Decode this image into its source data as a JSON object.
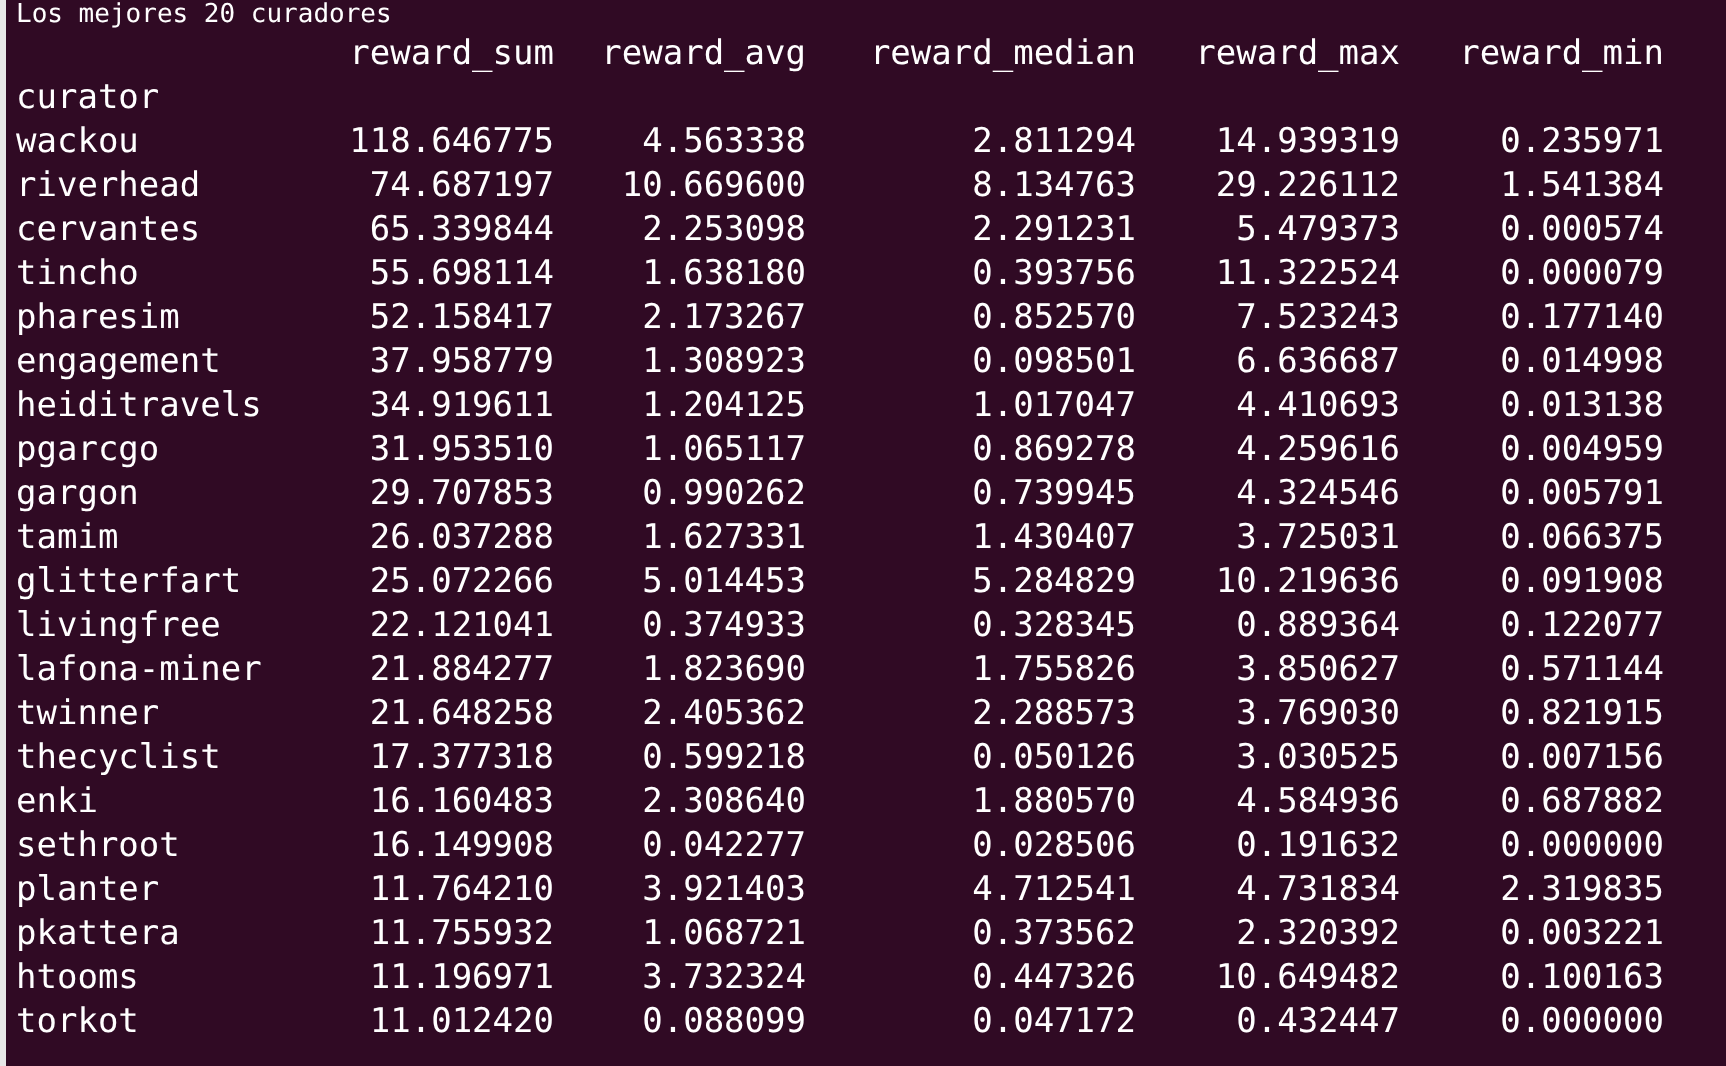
{
  "title": "Los mejores 20 curadores",
  "table": {
    "index_name": "curator",
    "columns": [
      "reward_sum",
      "reward_avg",
      "reward_median",
      "reward_max",
      "reward_min"
    ],
    "rows": [
      {
        "curator": "wackou",
        "values": [
          "118.646775",
          "4.563338",
          "2.811294",
          "14.939319",
          "0.235971"
        ]
      },
      {
        "curator": "riverhead",
        "values": [
          "74.687197",
          "10.669600",
          "8.134763",
          "29.226112",
          "1.541384"
        ]
      },
      {
        "curator": "cervantes",
        "values": [
          "65.339844",
          "2.253098",
          "2.291231",
          "5.479373",
          "0.000574"
        ]
      },
      {
        "curator": "tincho",
        "values": [
          "55.698114",
          "1.638180",
          "0.393756",
          "11.322524",
          "0.000079"
        ]
      },
      {
        "curator": "pharesim",
        "values": [
          "52.158417",
          "2.173267",
          "0.852570",
          "7.523243",
          "0.177140"
        ]
      },
      {
        "curator": "engagement",
        "values": [
          "37.958779",
          "1.308923",
          "0.098501",
          "6.636687",
          "0.014998"
        ]
      },
      {
        "curator": "heiditravels",
        "values": [
          "34.919611",
          "1.204125",
          "1.017047",
          "4.410693",
          "0.013138"
        ]
      },
      {
        "curator": "pgarcgo",
        "values": [
          "31.953510",
          "1.065117",
          "0.869278",
          "4.259616",
          "0.004959"
        ]
      },
      {
        "curator": "gargon",
        "values": [
          "29.707853",
          "0.990262",
          "0.739945",
          "4.324546",
          "0.005791"
        ]
      },
      {
        "curator": "tamim",
        "values": [
          "26.037288",
          "1.627331",
          "1.430407",
          "3.725031",
          "0.066375"
        ]
      },
      {
        "curator": "glitterfart",
        "values": [
          "25.072266",
          "5.014453",
          "5.284829",
          "10.219636",
          "0.091908"
        ]
      },
      {
        "curator": "livingfree",
        "values": [
          "22.121041",
          "0.374933",
          "0.328345",
          "0.889364",
          "0.122077"
        ]
      },
      {
        "curator": "lafona-miner",
        "values": [
          "21.884277",
          "1.823690",
          "1.755826",
          "3.850627",
          "0.571144"
        ]
      },
      {
        "curator": "twinner",
        "values": [
          "21.648258",
          "2.405362",
          "2.288573",
          "3.769030",
          "0.821915"
        ]
      },
      {
        "curator": "thecyclist",
        "values": [
          "17.377318",
          "0.599218",
          "0.050126",
          "3.030525",
          "0.007156"
        ]
      },
      {
        "curator": "enki",
        "values": [
          "16.160483",
          "2.308640",
          "1.880570",
          "4.584936",
          "0.687882"
        ]
      },
      {
        "curator": "sethroot",
        "values": [
          "16.149908",
          "0.042277",
          "0.028506",
          "0.191632",
          "0.000000"
        ]
      },
      {
        "curator": "planter",
        "values": [
          "11.764210",
          "3.921403",
          "4.712541",
          "4.731834",
          "2.319835"
        ]
      },
      {
        "curator": "pkattera",
        "values": [
          "11.755932",
          "1.068721",
          "0.373562",
          "2.320392",
          "0.003221"
        ]
      },
      {
        "curator": "htooms",
        "values": [
          "11.196971",
          "3.732324",
          "0.447326",
          "10.649482",
          "0.100163"
        ]
      },
      {
        "curator": "torkot",
        "values": [
          "11.012420",
          "0.088099",
          "0.047172",
          "0.432447",
          "0.000000"
        ]
      }
    ]
  }
}
